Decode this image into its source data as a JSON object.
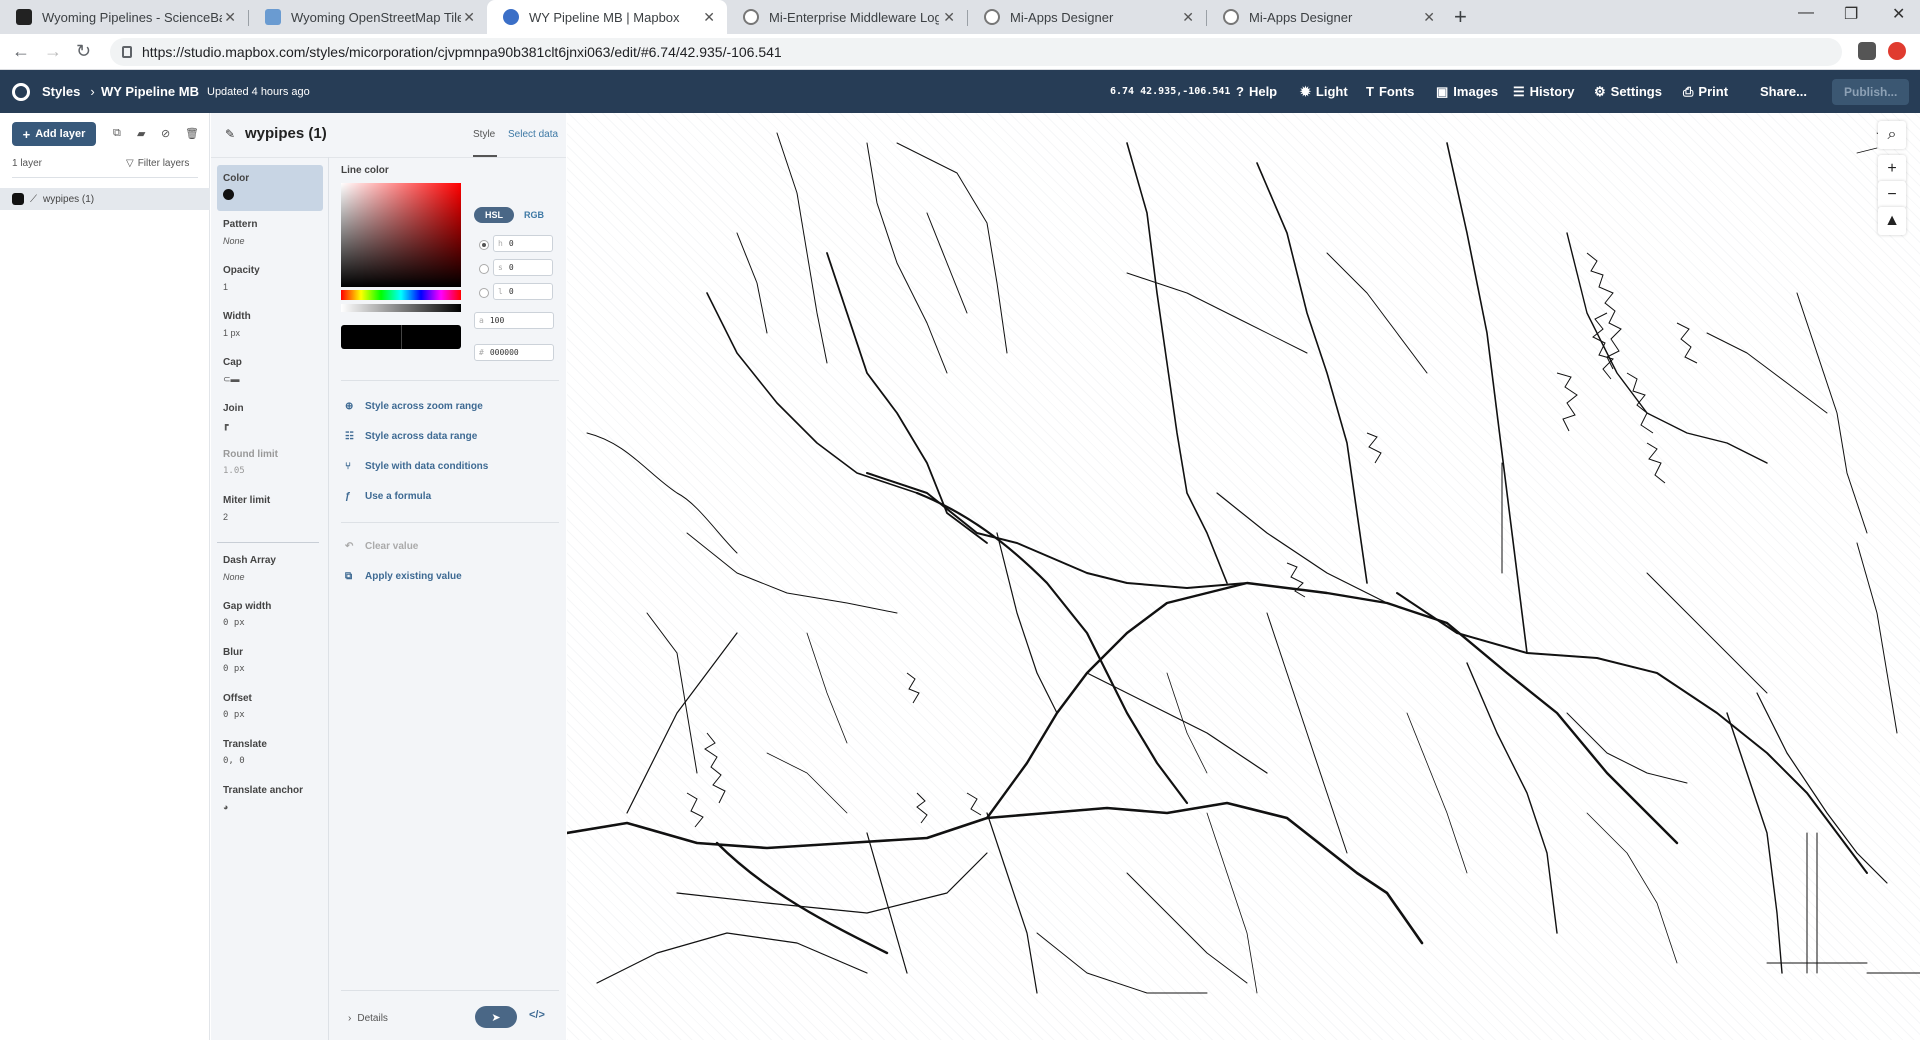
{
  "browser": {
    "tabs": [
      {
        "title": "Wyoming Pipelines - ScienceBase",
        "favicon_color": "#222222",
        "active": false
      },
      {
        "title": "Wyoming OpenStreetMap Tiles, G",
        "favicon_color": "#6a9bd1",
        "active": false
      },
      {
        "title": "WY Pipeline MB | Mapbox",
        "favicon_color": "#3b6fc7",
        "active": true
      },
      {
        "title": "Mi-Enterprise Middleware Login",
        "favicon_color": "#777777",
        "active": false
      },
      {
        "title": "Mi-Apps Designer",
        "favicon_color": "#777777",
        "active": false
      },
      {
        "title": "Mi-Apps Designer",
        "favicon_color": "#777777",
        "active": false
      }
    ],
    "url": "https://studio.mapbox.com/styles/micorporation/cjvpmnpa90b381clt6jnxi063/edit/#6.74/42.935/-106.541"
  },
  "header": {
    "styles_label": "Styles",
    "style_name": "WY Pipeline MB",
    "updated": "Updated 4 hours ago",
    "coords": "6.74 42.935,-106.541",
    "help": "Help",
    "light": "Light",
    "fonts": "Fonts",
    "images": "Images",
    "history": "History",
    "settings": "Settings",
    "print": "Print",
    "share": "Share...",
    "publish": "Publish..."
  },
  "layers": {
    "add_layer": "Add layer",
    "count": "1 layer",
    "filter": "Filter layers",
    "items": [
      {
        "name": "wypipes (1)",
        "color": "#111111"
      }
    ]
  },
  "panel": {
    "title": "wypipes (1)",
    "tab_style": "Style",
    "tab_select": "Select data",
    "properties": [
      {
        "name": "Color",
        "value": ""
      },
      {
        "name": "Pattern",
        "value": "None"
      },
      {
        "name": "Opacity",
        "value": "1"
      },
      {
        "name": "Width",
        "value": "1 px"
      },
      {
        "name": "Cap",
        "value": ""
      },
      {
        "name": "Join",
        "value": ""
      },
      {
        "name": "Round limit",
        "value": "1.05"
      },
      {
        "name": "Miter limit",
        "value": "2"
      },
      {
        "name": "Dash Array",
        "value": "None"
      },
      {
        "name": "Gap width",
        "value": "0 px"
      },
      {
        "name": "Blur",
        "value": "0 px"
      },
      {
        "name": "Offset",
        "value": "0 px"
      },
      {
        "name": "Translate",
        "value": "0, 0"
      },
      {
        "name": "Translate anchor",
        "value": ""
      }
    ],
    "editor": {
      "label": "Line color",
      "hsl": "HSL",
      "rgb": "RGB",
      "h_label": "h",
      "h": "0",
      "s_label": "s",
      "s": "0",
      "l_label": "l",
      "l": "0",
      "a_label": "a",
      "a": "100",
      "hex_label": "#",
      "hex": "000000",
      "links": [
        "Style across zoom range",
        "Style across data range",
        "Style with data conditions",
        "Use a formula"
      ],
      "clear": "Clear value",
      "apply": "Apply existing value"
    },
    "details": "Details"
  }
}
